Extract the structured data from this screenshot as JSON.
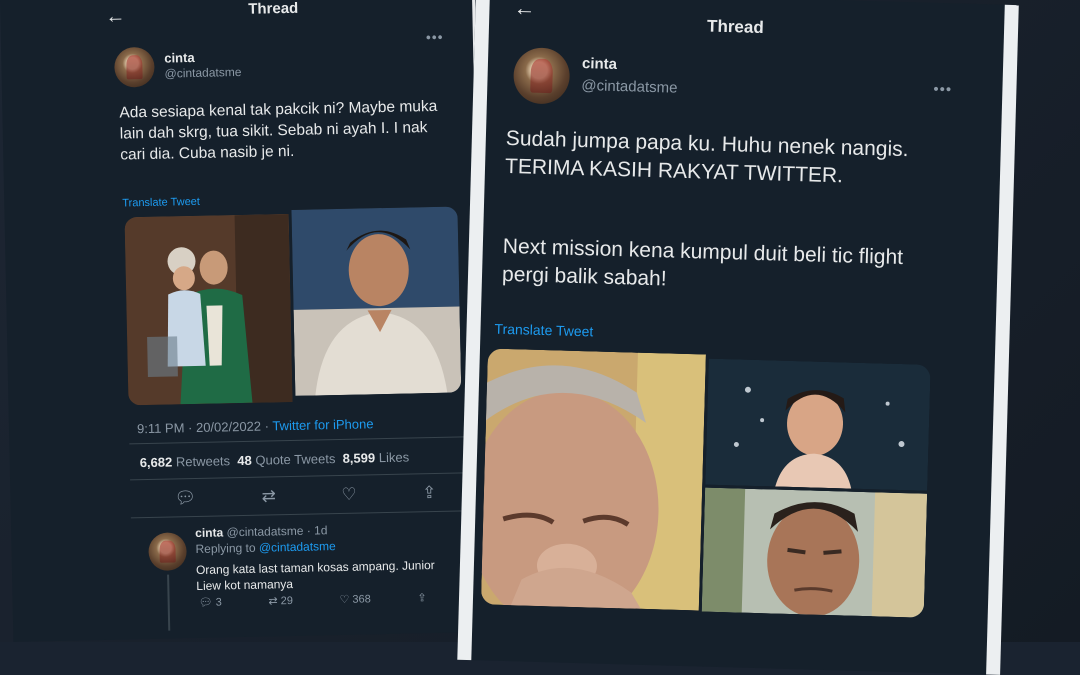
{
  "left": {
    "header_title": "Thread",
    "author": {
      "name": "cinta",
      "handle": "@cintadatsme"
    },
    "tweet_text": "Ada sesiapa kenal tak pakcik ni? Maybe muka lain dah skrg, tua sikit. Sebab ni ayah I. I nak cari dia. Cuba nasib je ni.",
    "translate_label": "Translate Tweet",
    "meta": {
      "time": "9:11 PM · 20/02/2022 · ",
      "app": "Twitter for iPhone"
    },
    "stats": {
      "retweets": "6,682",
      "retweets_label": "Retweets",
      "quotes": "48",
      "quotes_label": "Quote Tweets",
      "likes": "8,599",
      "likes_label": "Likes"
    },
    "reply": {
      "name": "cinta",
      "handle_time": "@cintadatsme · 1d",
      "replying_prefix": "Replying to ",
      "replying_to": "@cintadatsme",
      "text": "Orang kata last taman kosas ampang. Junior Liew kot namanya",
      "reply_count": "3",
      "retweet_count": "29",
      "like_count": "368"
    }
  },
  "right": {
    "header_title": "Thread",
    "author": {
      "name": "cinta",
      "handle": "@cintadatsme"
    },
    "tweet_text_1": "Sudah jumpa papa ku. Huhu nenek nangis. TERIMA KASIH RAKYAT TWITTER.",
    "tweet_text_2": "Next mission kena kumpul duit beli tic flight pergi balik sabah!",
    "translate_label": "Translate Tweet"
  },
  "icons": {
    "back": "arrow-left-icon",
    "more": "more-dots-icon",
    "reply": "comment-icon",
    "retweet": "retweet-icon",
    "like": "heart-icon",
    "share": "share-icon"
  }
}
